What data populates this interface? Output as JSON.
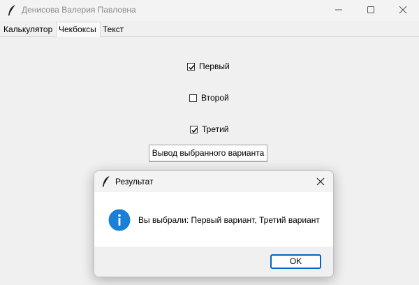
{
  "window": {
    "title": "Денисова Валерия Павловна"
  },
  "tabs": [
    {
      "label": "Калькулятор"
    },
    {
      "label": "Чекбоксы",
      "active": true
    },
    {
      "label": "Текст"
    }
  ],
  "checkboxes": [
    {
      "label": "Первый",
      "checked": true
    },
    {
      "label": "Второй",
      "checked": false
    },
    {
      "label": "Третий",
      "checked": true
    }
  ],
  "action_button": {
    "label": "Вывод выбранного варианта"
  },
  "dialog": {
    "title": "Результат",
    "message": "Вы выбрали: Первый вариант, Третий вариант",
    "ok_label": "OK",
    "icon": "info-icon"
  },
  "colors": {
    "info_blue": "#1a7fd6",
    "ok_border": "#0067c0"
  }
}
